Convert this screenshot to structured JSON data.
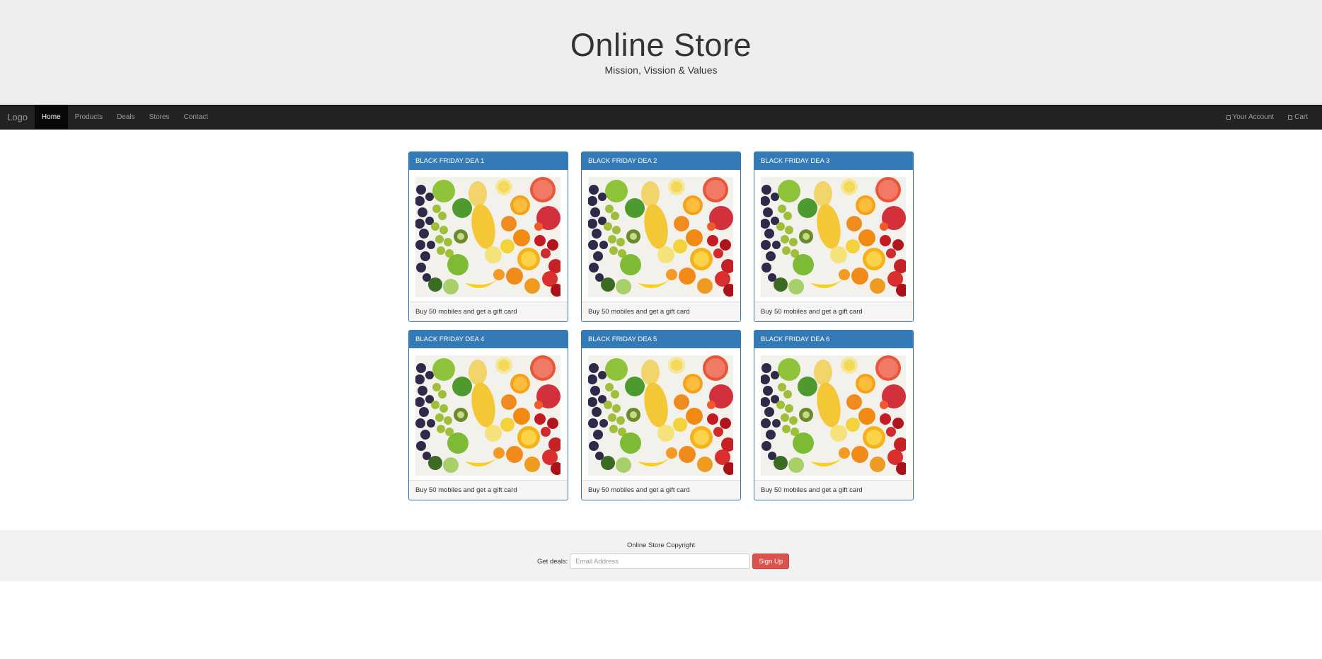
{
  "header": {
    "title": "Online Store",
    "subtitle": "Mission, Vission & Values"
  },
  "navbar": {
    "brand": "Logo",
    "items": [
      {
        "label": "Home",
        "active": true
      },
      {
        "label": "Products",
        "active": false
      },
      {
        "label": "Deals",
        "active": false
      },
      {
        "label": "Stores",
        "active": false
      },
      {
        "label": "Contact",
        "active": false
      }
    ],
    "right": [
      {
        "label": "Your Account",
        "icon": "user-icon"
      },
      {
        "label": "Cart",
        "icon": "cart-icon"
      }
    ]
  },
  "deals": [
    {
      "title": "BLACK FRIDAY DEA 1",
      "footer": "Buy 50 mobiles and get a gift card"
    },
    {
      "title": "BLACK FRIDAY DEA 2",
      "footer": "Buy 50 mobiles and get a gift card"
    },
    {
      "title": "BLACK FRIDAY DEA 3",
      "footer": "Buy 50 mobiles and get a gift card"
    },
    {
      "title": "BLACK FRIDAY DEA 4",
      "footer": "Buy 50 mobiles and get a gift card"
    },
    {
      "title": "BLACK FRIDAY DEA 5",
      "footer": "Buy 50 mobiles and get a gift card"
    },
    {
      "title": "BLACK FRIDAY DEA 6",
      "footer": "Buy 50 mobiles and get a gift card"
    }
  ],
  "footer": {
    "copyright": "Online Store Copyright",
    "deals_label": "Get deals:",
    "email_placeholder": "Email Address",
    "signup_label": "Sign Up"
  },
  "colors": {
    "panel_primary": "#337ab7",
    "navbar_bg": "#222222",
    "signup_button": "#d9534f"
  }
}
